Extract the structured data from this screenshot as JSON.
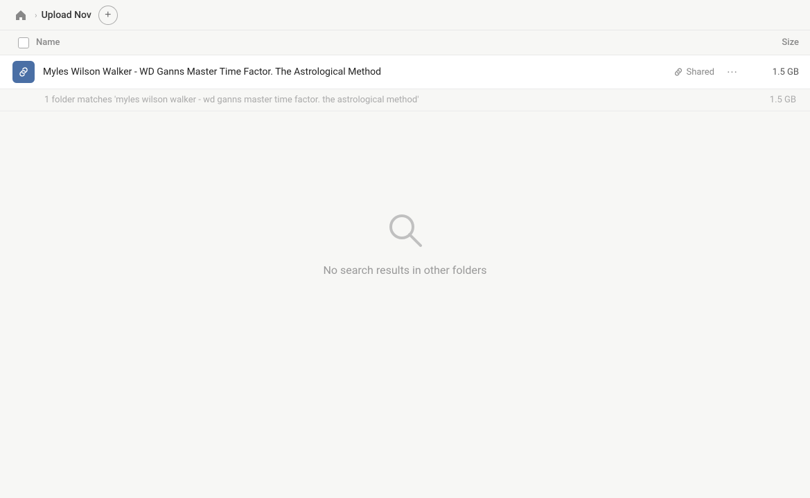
{
  "topbar": {
    "home_icon": "🏠",
    "breadcrumb_separator": ">",
    "breadcrumb_label": "Upload Nov",
    "add_button_label": "+"
  },
  "table_header": {
    "name_label": "Name",
    "size_label": "Size"
  },
  "file_row": {
    "name": "Myles Wilson Walker - WD Ganns Master Time Factor. The Astrological Method",
    "shared_label": "Shared",
    "more_label": "···",
    "size": "1.5 GB"
  },
  "match_info": {
    "text": "1 folder matches 'myles wilson walker - wd ganns master time factor. the astrological method'",
    "size": "1.5 GB"
  },
  "empty_state": {
    "text": "No search results in other folders"
  }
}
